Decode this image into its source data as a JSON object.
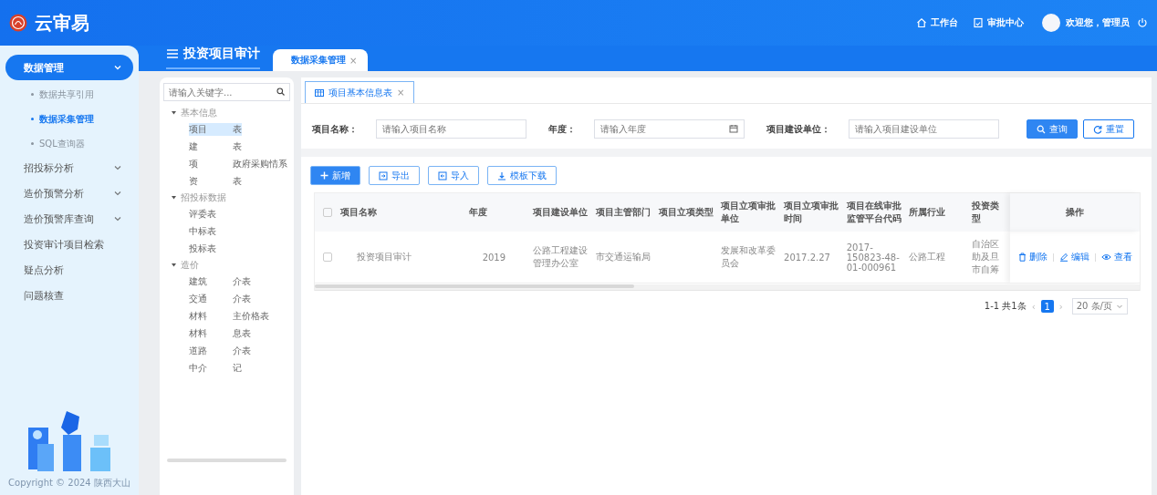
{
  "header": {
    "app_name": "云审易",
    "links": [
      {
        "label": "工作台",
        "kind": "home"
      },
      {
        "label": "审批中心",
        "kind": "approval"
      }
    ],
    "user": "欢迎您，管理员"
  },
  "sidebar": {
    "items": [
      {
        "label": "数据管理",
        "kind": "menu",
        "selected": true,
        "expanded": true,
        "children": [
          {
            "label": "数据共享引用",
            "selected": false
          },
          {
            "label": "数据采集管理",
            "selected": true
          },
          {
            "label": "SQL查询器",
            "selected": false
          }
        ]
      },
      {
        "label": "招投标分析",
        "kind": "menu",
        "selected": false,
        "expanded": false
      },
      {
        "label": "造价预警分析",
        "kind": "menu",
        "selected": false,
        "expanded": false
      },
      {
        "label": "造价预警库查询",
        "kind": "menu",
        "selected": false,
        "expanded": false
      },
      {
        "label": "投资审计项目检索",
        "kind": "link",
        "selected": false
      },
      {
        "label": "疑点分析",
        "kind": "link",
        "selected": false
      },
      {
        "label": "问题核查",
        "kind": "link",
        "selected": false
      }
    ],
    "copyright": "Copyright © 2024 陕西大山"
  },
  "page_title": "投资项目审计",
  "tabs": [
    {
      "label": "数据采集管理",
      "selected": true,
      "close": "×"
    }
  ],
  "tree": {
    "placeholder": "请输入关键字...",
    "groups": [
      {
        "label": "基本信息",
        "expanded": true,
        "children": [
          {
            "parts": [
              "项目",
              "表"
            ],
            "selected": true
          },
          {
            "parts": [
              "建",
              "表"
            ],
            "selected": false
          },
          {
            "parts": [
              "项",
              "政府采购情系"
            ],
            "selected": false
          },
          {
            "parts": [
              "资",
              "表"
            ],
            "selected": false
          }
        ]
      },
      {
        "label": "招投标数据",
        "expanded": true,
        "children": [
          {
            "parts": [
              "评委表"
            ],
            "selected": false
          },
          {
            "parts": [
              "中标表"
            ],
            "selected": false
          },
          {
            "parts": [
              "投标表"
            ],
            "selected": false
          }
        ]
      },
      {
        "label": "造价",
        "expanded": true,
        "children": [
          {
            "parts": [
              "建筑",
              "介表"
            ],
            "selected": false
          },
          {
            "parts": [
              "交通",
              "介表"
            ],
            "selected": false
          },
          {
            "parts": [
              "材料",
              "主价格表"
            ],
            "selected": false
          },
          {
            "parts": [
              "材料",
              "息表"
            ],
            "selected": false
          },
          {
            "parts": [
              "道路",
              "介表"
            ],
            "selected": false
          },
          {
            "parts": [
              "中介",
              "记"
            ],
            "selected": false
          }
        ]
      }
    ]
  },
  "main": {
    "tabs": [
      {
        "label": "项目基本信息表",
        "selected": true,
        "close": "×"
      }
    ],
    "filters": [
      {
        "label": "项目名称：",
        "placeholder": "请输入项目名称",
        "kind": "text"
      },
      {
        "label": "年度：",
        "placeholder": "请输入年度",
        "kind": "date"
      },
      {
        "label": "项目建设单位：",
        "placeholder": "请输入项目建设单位",
        "kind": "text"
      }
    ],
    "form_buttons": [
      {
        "label": "查询",
        "kind": "search"
      },
      {
        "label": "重置",
        "kind": "reset"
      }
    ],
    "toolbar": [
      {
        "label": "新增",
        "kind": "add"
      },
      {
        "label": "导出",
        "kind": "export"
      },
      {
        "label": "导入",
        "kind": "import"
      },
      {
        "label": "模板下载",
        "kind": "download"
      }
    ],
    "table": {
      "all_checked": false,
      "columns": [
        "项目名称",
        "年度",
        "项目建设单位",
        "项目主管部门",
        "项目立项类型",
        "项目立项审批单位",
        "项目立项审批时间",
        "项目在线审批监管平台代码",
        "所属行业",
        "投资类型",
        "操作"
      ],
      "rows": [
        {
          "checked": false,
          "cells": [
            "投资项目审计",
            "2019",
            "公路工程建设管理办公室",
            "市交通运输局",
            "",
            "发展和改革委员会",
            "2017.2.27",
            "2017-150823-48-01-000961",
            "公路工程",
            "自治区助及旦市自筹"
          ],
          "actions": [
            {
              "label": "删除",
              "kind": "delete"
            },
            {
              "label": "编辑",
              "kind": "edit"
            },
            {
              "label": "查看",
              "kind": "view"
            }
          ]
        }
      ]
    },
    "pagination": {
      "summary": "1-1 共1条",
      "prev": "‹",
      "pages": [
        {
          "label": "1",
          "selected": true
        }
      ],
      "next": "›",
      "page_size": "20 条/页"
    }
  }
}
